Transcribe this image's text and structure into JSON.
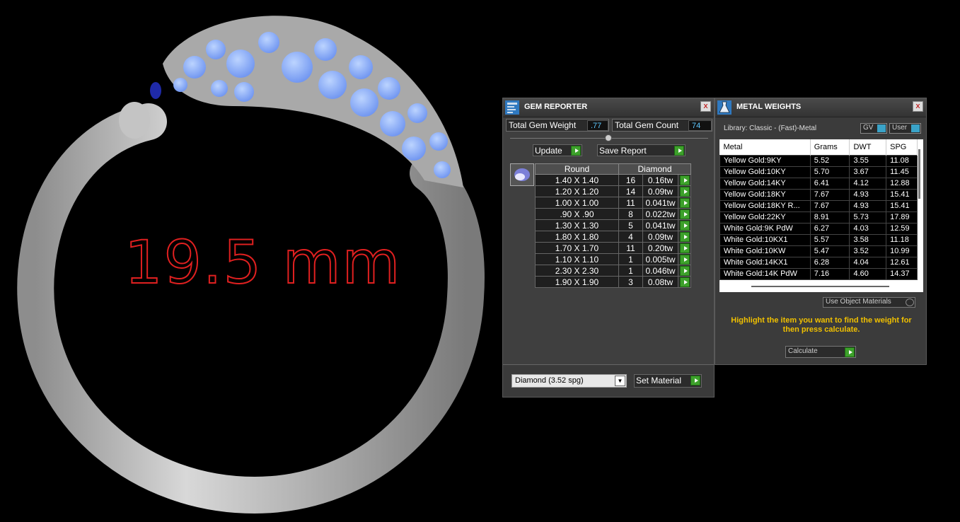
{
  "viewport": {
    "measurement": "19.5 mm"
  },
  "gem_reporter": {
    "title": "GEM REPORTER",
    "close": "x",
    "total_weight_label": "Total Gem Weight",
    "total_weight_value": ".77",
    "total_count_label": "Total Gem Count",
    "total_count_value": "74",
    "update_label": "Update",
    "save_report_label": "Save Report",
    "table_header": [
      "Round",
      "Diamond"
    ],
    "rows": [
      {
        "size": "1.40 X 1.40",
        "count": "16",
        "weight": "0.16tw"
      },
      {
        "size": "1.20 X 1.20",
        "count": "14",
        "weight": "0.09tw"
      },
      {
        "size": "1.00 X 1.00",
        "count": "11",
        "weight": "0.041tw"
      },
      {
        "size": ".90 X .90",
        "count": "8",
        "weight": "0.022tw"
      },
      {
        "size": "1.30 X 1.30",
        "count": "5",
        "weight": "0.041tw"
      },
      {
        "size": "1.80 X 1.80",
        "count": "4",
        "weight": "0.09tw"
      },
      {
        "size": "1.70 X 1.70",
        "count": "11",
        "weight": "0.20tw"
      },
      {
        "size": "1.10 X 1.10",
        "count": "1",
        "weight": "0.005tw"
      },
      {
        "size": "2.30 X 2.30",
        "count": "1",
        "weight": "0.046tw"
      },
      {
        "size": "1.90 X 1.90",
        "count": "3",
        "weight": "0.08tw"
      }
    ],
    "material_select": "Diamond     (3.52 spg)",
    "set_material_label": "Set Material"
  },
  "metal_weights": {
    "title": "METAL WEIGHTS",
    "close": "x",
    "library": "Library: Classic - (Fast)-Metal",
    "gv_label": "GV",
    "user_label": "User",
    "columns": [
      "Metal",
      "Grams",
      "DWT",
      "SPG"
    ],
    "rows": [
      {
        "metal": "Yellow Gold:9KY",
        "grams": "5.52",
        "dwt": "3.55",
        "spg": "11.08"
      },
      {
        "metal": "Yellow Gold:10KY",
        "grams": "5.70",
        "dwt": "3.67",
        "spg": "11.45"
      },
      {
        "metal": "Yellow Gold:14KY",
        "grams": "6.41",
        "dwt": "4.12",
        "spg": "12.88"
      },
      {
        "metal": "Yellow Gold:18KY",
        "grams": "7.67",
        "dwt": "4.93",
        "spg": "15.41"
      },
      {
        "metal": "Yellow Gold:18KY R...",
        "grams": "7.67",
        "dwt": "4.93",
        "spg": "15.41"
      },
      {
        "metal": "Yellow Gold:22KY",
        "grams": "8.91",
        "dwt": "5.73",
        "spg": "17.89"
      },
      {
        "metal": "White Gold:9K PdW",
        "grams": "6.27",
        "dwt": "4.03",
        "spg": "12.59"
      },
      {
        "metal": "White Gold:10KX1",
        "grams": "5.57",
        "dwt": "3.58",
        "spg": "11.18"
      },
      {
        "metal": "White Gold:10KW",
        "grams": "5.47",
        "dwt": "3.52",
        "spg": "10.99"
      },
      {
        "metal": "White Gold:14KX1",
        "grams": "6.28",
        "dwt": "4.04",
        "spg": "12.61"
      },
      {
        "metal": "White Gold:14K PdW",
        "grams": "7.16",
        "dwt": "4.60",
        "spg": "14.37"
      }
    ],
    "use_object_materials": "Use Object Materials",
    "hint": "Highlight the item you want to find the weight for then press calculate.",
    "calculate_label": "Calculate"
  }
}
